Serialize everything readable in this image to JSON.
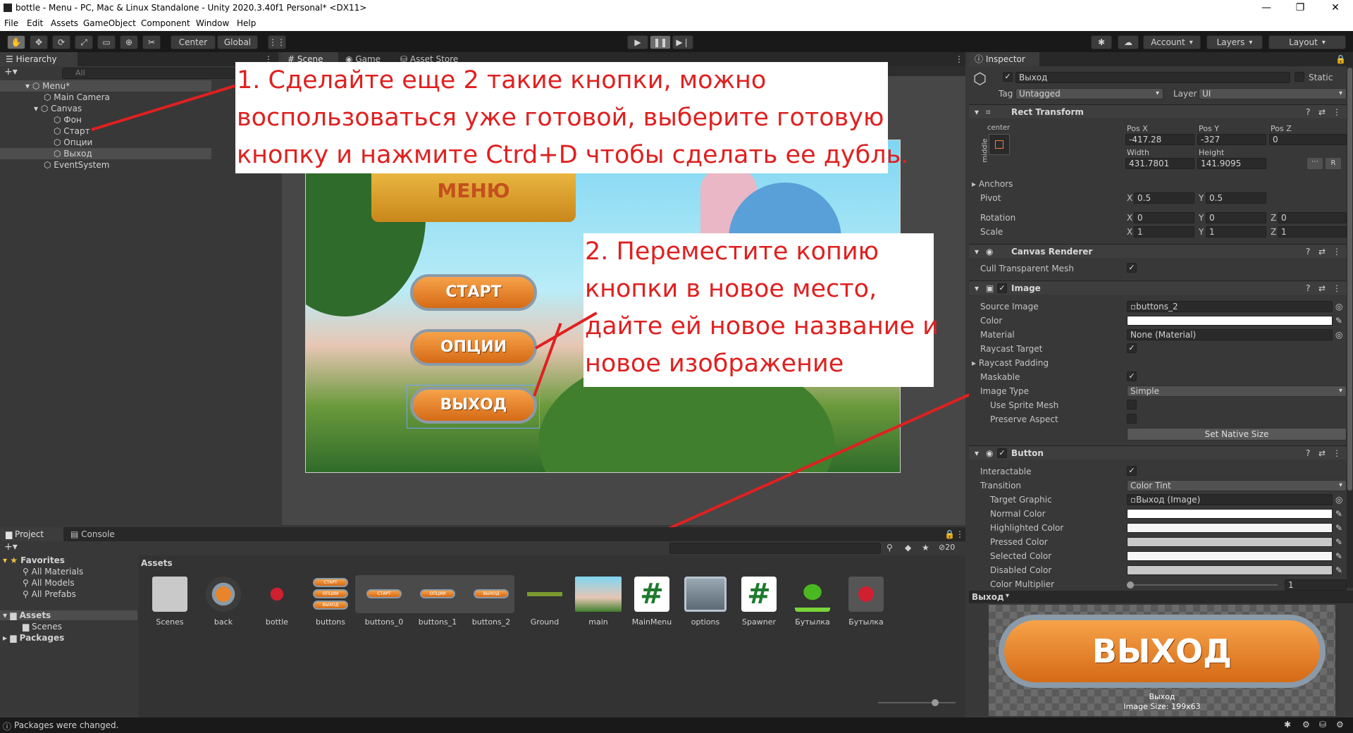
{
  "window": {
    "title": "bottle - Menu - PC, Mac & Linux Standalone - Unity 2020.3.40f1 Personal* <DX11>",
    "minimize_glyph": "—",
    "maximize_glyph": "❐",
    "close_glyph": "✕"
  },
  "menu": [
    "File",
    "Edit",
    "Assets",
    "GameObject",
    "Component",
    "Window",
    "Help"
  ],
  "toolbar": {
    "pivot_label": "Center",
    "space_label": "Global",
    "account_label": "Account",
    "layers_label": "Layers",
    "layout_label": "Layout"
  },
  "hierarchy": {
    "tab_label": "Hierarchy",
    "search_placeholder": "All",
    "items": [
      {
        "label": "Menu*",
        "level": 0
      },
      {
        "label": "Main Camera",
        "level": 1
      },
      {
        "label": "Canvas",
        "level": 1
      },
      {
        "label": "Фон",
        "level": 2
      },
      {
        "label": "Старт",
        "level": 2
      },
      {
        "label": "Опции",
        "level": 2
      },
      {
        "label": "Выход",
        "level": 2
      },
      {
        "label": "EventSystem",
        "level": 1
      }
    ]
  },
  "scene": {
    "tabs": [
      "Scene",
      "Game",
      "Asset Store"
    ],
    "game_menu_title": "МЕНЮ",
    "game_buttons": [
      "СТАРТ",
      "ОПЦИИ",
      "ВЫХОД"
    ]
  },
  "callouts": {
    "first": [
      "1. Сделайте еще 2 такие кнопки, можно",
      "воспользоваться уже готовой, выберите готовую",
      "кнопку и нажмите Ctrd+D чтобы сделать ее дубль."
    ],
    "second": [
      "2. Переместите копию",
      "кнопки в новое место,",
      "дайте ей новое название и",
      "новое изображение"
    ]
  },
  "inspector": {
    "tab_label": "Inspector",
    "object_name": "Выход",
    "static_label": "Static",
    "tag_label": "Tag",
    "tag_value": "Untagged",
    "layer_label": "Layer",
    "layer_value": "UI",
    "rect_transform": {
      "title": "Rect Transform",
      "anchor_h": "center",
      "anchor_v": "middle",
      "pos_x_label": "Pos X",
      "pos_y_label": "Pos Y",
      "pos_z_label": "Pos Z",
      "pos_x": "-417.28",
      "pos_y": "-327",
      "pos_z": "0",
      "width_label": "Width",
      "height_label": "Height",
      "width": "431.7801",
      "height": "141.9095",
      "anchors_label": "Anchors",
      "pivot_label": "Pivot",
      "pivot_x": "0.5",
      "pivot_y": "0.5",
      "rotation_label": "Rotation",
      "rot_x": "0",
      "rot_y": "0",
      "rot_z": "0",
      "scale_label": "Scale",
      "scale_x": "1",
      "scale_y": "1",
      "scale_z": "1",
      "axis_x": "X",
      "axis_y": "Y",
      "axis_z": "Z",
      "raw_label": "R"
    },
    "canvas_renderer": {
      "title": "Canvas Renderer",
      "cull_label": "Cull Transparent Mesh"
    },
    "image": {
      "title": "Image",
      "source_image_label": "Source Image",
      "source_image_value": "buttons_2",
      "color_label": "Color",
      "material_label": "Material",
      "material_value": "None (Material)",
      "raycast_target_label": "Raycast Target",
      "raycast_padding_label": "Raycast Padding",
      "maskable_label": "Maskable",
      "image_type_label": "Image Type",
      "image_type_value": "Simple",
      "use_sprite_mesh_label": "Use Sprite Mesh",
      "preserve_aspect_label": "Preserve Aspect",
      "set_native_size_label": "Set Native Size"
    },
    "button": {
      "title": "Button",
      "interactable_label": "Interactable",
      "transition_label": "Transition",
      "transition_value": "Color Tint",
      "target_graphic_label": "Target Graphic",
      "target_graphic_value": "Выход (Image)",
      "normal_color_label": "Normal Color",
      "highlighted_color_label": "Highlighted Color",
      "pressed_color_label": "Pressed Color",
      "selected_color_label": "Selected Color",
      "disabled_color_label": "Disabled Color",
      "color_multiplier_label": "Color Multiplier",
      "color_multiplier_value": "1"
    },
    "preview": {
      "header": "Выход",
      "image_text": "ВЫХОД",
      "caption_name": "Выход",
      "caption_size": "Image Size: 199x63"
    }
  },
  "project": {
    "tabs": [
      "Project",
      "Console"
    ],
    "favorites_label": "Favorites",
    "favorites": [
      "All Materials",
      "All Models",
      "All Prefabs"
    ],
    "assets_label": "Assets",
    "assets_children": [
      "Scenes"
    ],
    "packages_label": "Packages",
    "breadcrumb": "Assets",
    "hidden_count": "20",
    "assets": [
      {
        "label": "Scenes",
        "kind": "folder"
      },
      {
        "label": "back",
        "kind": "sprite"
      },
      {
        "label": "bottle",
        "kind": "sprite"
      },
      {
        "label": "buttons",
        "kind": "sprite"
      },
      {
        "label": "buttons_0",
        "kind": "subsprite"
      },
      {
        "label": "buttons_1",
        "kind": "subsprite"
      },
      {
        "label": "buttons_2",
        "kind": "subsprite"
      },
      {
        "label": "Ground",
        "kind": "sprite"
      },
      {
        "label": "main",
        "kind": "sprite"
      },
      {
        "label": "MainMenu",
        "kind": "script"
      },
      {
        "label": "options",
        "kind": "sprite"
      },
      {
        "label": "Spawner",
        "kind": "script"
      },
      {
        "label": "Бутылка",
        "kind": "prefab"
      },
      {
        "label": "Бутылка",
        "kind": "prefab"
      }
    ],
    "mini_buttons": [
      "СТАРТ",
      "ОПЦИИ",
      "ВЫХОД"
    ],
    "script_glyph": "#"
  },
  "status": {
    "message": "Packages were changed."
  },
  "colors": {
    "accent_red": "#e02020",
    "selection": "#2c5d87",
    "button_orange": "#e8852a"
  }
}
